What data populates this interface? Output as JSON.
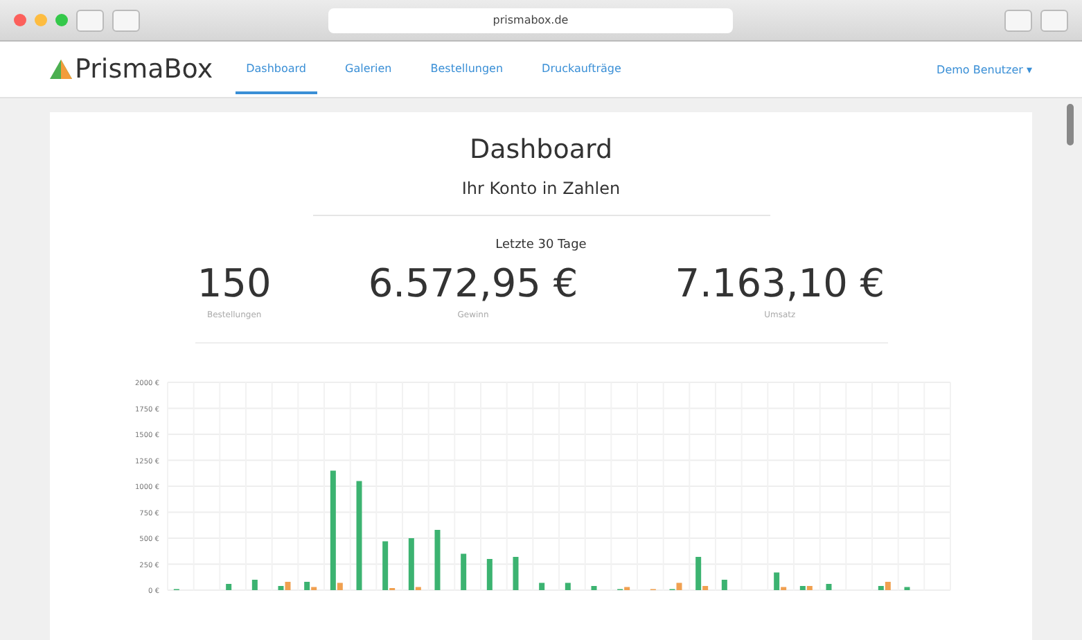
{
  "browser": {
    "url": "prismabox.de"
  },
  "nav": {
    "logo": "PrismaBox",
    "tabs": [
      {
        "label": "Dashboard",
        "selected": true
      },
      {
        "label": "Galerien",
        "selected": false
      },
      {
        "label": "Bestellungen",
        "selected": false
      },
      {
        "label": "Druckaufträge",
        "selected": false
      }
    ],
    "user": "Demo Benutzer ▾"
  },
  "header": {
    "title": "Dashboard",
    "subtitle": "Ihr Konto in Zahlen",
    "period": "Letzte 30 Tage"
  },
  "stats": [
    {
      "value": "150",
      "label": "Bestellungen"
    },
    {
      "value": "6.572,95 €",
      "label": "Gewinn"
    },
    {
      "value": "7.163,10 €",
      "label": "Umsatz"
    }
  ],
  "chart_data": {
    "type": "bar",
    "grid": true,
    "ylim": [
      0,
      2000
    ],
    "yticks": [
      {
        "value": 0,
        "label": "0 €"
      },
      {
        "value": 250,
        "label": "250 €"
      },
      {
        "value": 500,
        "label": "500 €"
      },
      {
        "value": 750,
        "label": "750 €"
      },
      {
        "value": 1000,
        "label": "1000 €"
      },
      {
        "value": 1250,
        "label": "1250 €"
      },
      {
        "value": 1500,
        "label": "1500 €"
      },
      {
        "value": 1750,
        "label": "1750 €"
      },
      {
        "value": 2000,
        "label": "2000 €"
      }
    ],
    "series": [
      {
        "color": "#3cb371",
        "values": [
          10,
          0,
          60,
          100,
          40,
          80,
          1150,
          1050,
          470,
          500,
          580,
          350,
          300,
          320,
          70,
          70,
          40,
          10,
          0,
          10,
          320,
          100,
          0,
          170,
          40,
          60,
          0,
          40,
          30,
          0
        ]
      },
      {
        "color": "#f0a050",
        "values": [
          0,
          0,
          0,
          0,
          80,
          30,
          70,
          0,
          20,
          30,
          0,
          0,
          0,
          0,
          0,
          0,
          0,
          30,
          10,
          70,
          40,
          0,
          0,
          30,
          40,
          0,
          0,
          80,
          0,
          0
        ]
      }
    ]
  }
}
